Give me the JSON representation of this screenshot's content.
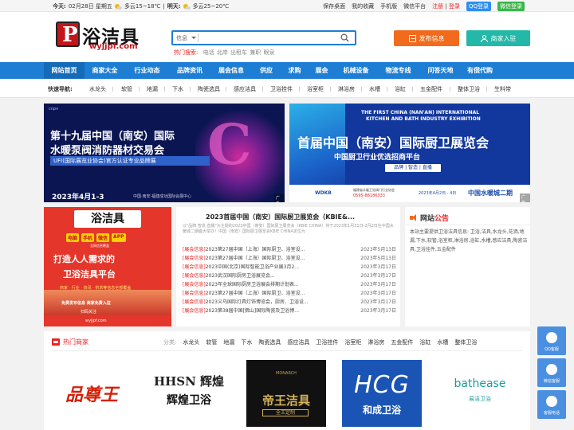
{
  "topbar": {
    "today_label": "今天:",
    "today_date": "02月28日 星期五",
    "today_weather": "多云15~18℃",
    "sep": "|",
    "tomorrow_label": "明天:",
    "tomorrow_weather": "多云25~20℃",
    "links": [
      "保存桌面",
      "我的收藏",
      "手机版",
      "微信平台"
    ],
    "login_reg": "注册",
    "login": "登录",
    "login_sep": "|",
    "qq_login": "QQ登录",
    "wx_login": "微信登录"
  },
  "header": {
    "logo_text": "浴洁具",
    "logo_url": "wyjjpf.com",
    "search_category": "信息",
    "hot_label": "热门搜索:",
    "hot_words": "电话 北岸 出租车 兼职 眼泉",
    "post_button": "发布信息",
    "join_button": "商家入驻"
  },
  "nav": {
    "items": [
      "网站首页",
      "商家大全",
      "行业动态",
      "品牌资讯",
      "展会信息",
      "供应",
      "求购",
      "展会",
      "机械设备",
      "物流专线",
      "问答天地",
      "有偿代购"
    ]
  },
  "quicknav": {
    "label": "快速导航:",
    "items": [
      "水龙头",
      "软管",
      "地漏",
      "下水",
      "陶瓷选具",
      "感应洁具",
      "卫浴挂件",
      "浴室柜",
      "淋浴房",
      "水槽",
      "浴缸",
      "五金配件",
      "整体卫浴",
      "生料带"
    ]
  },
  "banner1": {
    "logos": "cnpv",
    "line1": "第十九届中国（南安）国际",
    "line2": "水暖泵阀消防器材交易会",
    "bar": "UFI(国际展览业协会)官方认证专业品牌展",
    "date": "2023年4月1-3",
    "addr": "中国·南安·福建成功国际会展中心",
    "ad": "广告"
  },
  "banner2": {
    "en1": "THE FIRST CHINA (NAN'AN) INTERNATIONAL",
    "en2": "KITCHEN AND BATH INDUSTRY EXHIBITION",
    "title": "首届中国（南安）国际厨卫展览会",
    "subtitle": "中国厨卫行业优选招商平台",
    "tags": "品牌 | 智造 | 直播",
    "wk": "WDKB",
    "org": "福建省水暖卫浴阀门行业协会",
    "tel": "0595-86186333",
    "date": "2023年4月2日 - 4日",
    "loc": "中国水暖城二期",
    "ad": "广告"
  },
  "promo": {
    "logo": "浴洁具",
    "pills": [
      "电脑",
      "手机",
      "微信",
      "APP"
    ],
    "sub": "全网信息覆盖",
    "line1": "打造人人需求的",
    "line2": "卫浴洁具平台",
    "s1": "商家 · 行业 · 资讯 · 供求等信息全部覆盖",
    "s2": "免费发布信息  商家免费入驻",
    "s3": "扫码关注",
    "s4": "wyjjpf.com"
  },
  "news": {
    "title": "2023首届中国（南安）国际厨卫展览会（KBIE&...",
    "summary": "以\"品牌 智造 直播\"为主题的2023中国（南安）国际厨卫展览会（KBIE CHINA）将于2023年1月31日-2月2日在中国水暖城二期盛大举办！中国（南安）国际厨卫展览会KBIE CHINA定位为",
    "items": [
      {
        "tag": "[展会信息]",
        "title": "2023第27届中国（上海）国际厨卫、浴室设...",
        "date": "2023年5月13日"
      },
      {
        "tag": "[展会信息]",
        "title": "2023第27届中国（上海）国际厨卫、浴室设...",
        "date": "2023年5月13日"
      },
      {
        "tag": "[展会信息]",
        "title": "2023中国(北京)国际智能卫浴产业展3月2...",
        "date": "2023年3月17日"
      },
      {
        "tag": "[展会信息]",
        "title": "2023武汉国际厨房卫浴展览会...",
        "date": "2023年3月17日"
      },
      {
        "tag": "[展会信息]",
        "title": "2023年全球国际厨房卫浴展会排期计划表...",
        "date": "2023年3月17日"
      },
      {
        "tag": "[展会信息]",
        "title": "2023第27届中国（上海）国际厨卫、浴室设...",
        "date": "2023年3月17日"
      },
      {
        "tag": "[展会信息]",
        "title": "2023义乌国际灯具灯饰博览会，厨房、卫浴设...",
        "date": "2023年3月17日"
      },
      {
        "tag": "[展会信息]",
        "title": "2023第38届中国[佛山]国际陶瓷及卫浴博...",
        "date": "2023年3月17日"
      }
    ]
  },
  "notice": {
    "title_a": "网站",
    "title_b": "公告",
    "body": "本站主要提供卫浴洁具信息: 卫浴,洁具,水龙头,花洒,地漏,下水,软管,浴室柜,淋浴房,浴缸,水槽,感应洁具,陶瓷洁具,卫浴挂件,五金配件"
  },
  "brands": {
    "heading": "热门商家",
    "cat_label": "分类:",
    "categories": [
      "水龙头",
      "软管",
      "地漏",
      "下水",
      "陶瓷选具",
      "感应洁具",
      "卫浴挂件",
      "浴室柜",
      "淋浴房",
      "五金配件",
      "浴缸",
      "水槽",
      "整体卫浴"
    ],
    "b1": "品尊王",
    "b2_top": "HHSN 辉煌",
    "b2_sub": "辉煌卫浴",
    "b3_top": "MONARCH",
    "b3_main": "帝王洁具",
    "b3_sub": "全王定制",
    "b4_main": "HCG",
    "b4_sub": "和成卫浴",
    "b5_main": "bathease",
    "b5_sub": "易洁卫浴"
  },
  "sidefloat": {
    "qq": "QQ客服",
    "wx": "微信客服",
    "kf": "客服电话"
  }
}
